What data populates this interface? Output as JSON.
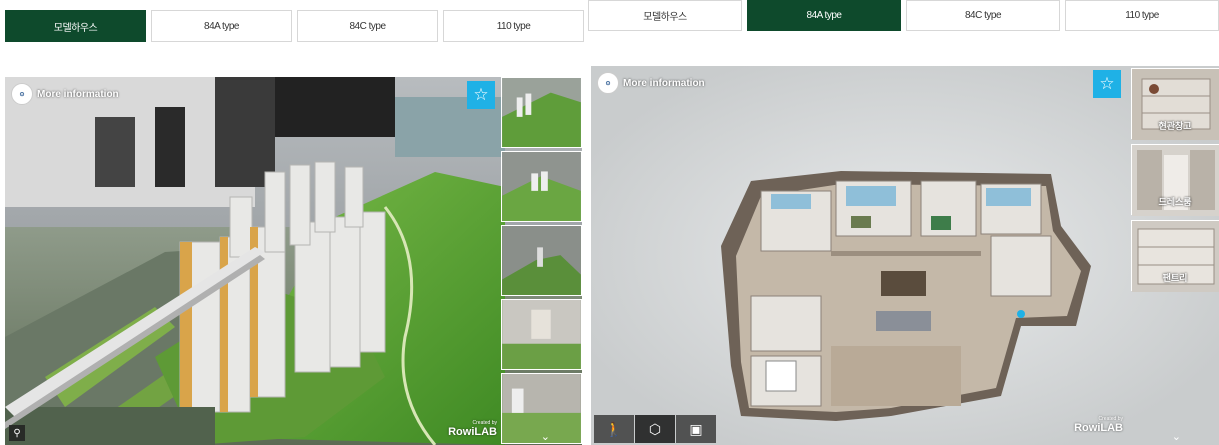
{
  "left": {
    "tabs": [
      {
        "label": "모델하우스",
        "active": true
      },
      {
        "label": "84A type",
        "active": false
      },
      {
        "label": "84C type",
        "active": false
      },
      {
        "label": "110 type",
        "active": false
      }
    ],
    "viewer": {
      "more_info": "More information",
      "credit_small": "Created by",
      "credit_big": "RowiLAB"
    }
  },
  "right": {
    "tabs": [
      {
        "label": "모델하우스",
        "active": false
      },
      {
        "label": "84A type",
        "active": true
      },
      {
        "label": "84C type",
        "active": false
      },
      {
        "label": "110 type",
        "active": false
      }
    ],
    "viewer": {
      "more_info": "More information",
      "credit_small": "Created by",
      "credit_big": "RowiLAB",
      "thumbs": [
        {
          "label": "현관창고"
        },
        {
          "label": "드레스룸"
        },
        {
          "label": "팬트리"
        }
      ]
    }
  },
  "colors": {
    "active_tab": "#0e4a2c",
    "star_button": "#1fb1e6"
  }
}
